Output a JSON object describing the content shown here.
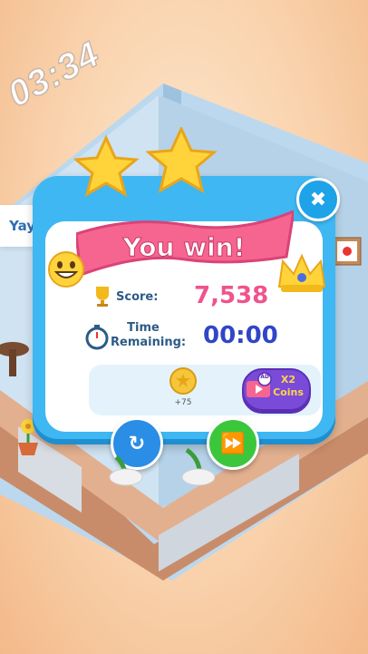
{
  "hud": {
    "timer": "03:34"
  },
  "speech": {
    "text": "Yay!"
  },
  "dialog": {
    "title": "You win!",
    "stars_earned": 2,
    "score_label": "Score:",
    "score_value": "7,538",
    "time_label_line1": "Time",
    "time_label_line2": "Remaining:",
    "time_value": "00:00",
    "coin_reward": "+75",
    "ad_badge": "AD",
    "ad_label_line1": "X2",
    "ad_label_line2": "Coins"
  },
  "icons": {
    "close": "close-icon",
    "restart": "restart-icon",
    "next": "fast-forward-icon"
  },
  "colors": {
    "panel": "#3fb7f2",
    "banner": "#f6658f",
    "score": "#f0538d",
    "time": "#3045c8",
    "restart": "#2a8de6",
    "next": "#3cc63c"
  }
}
